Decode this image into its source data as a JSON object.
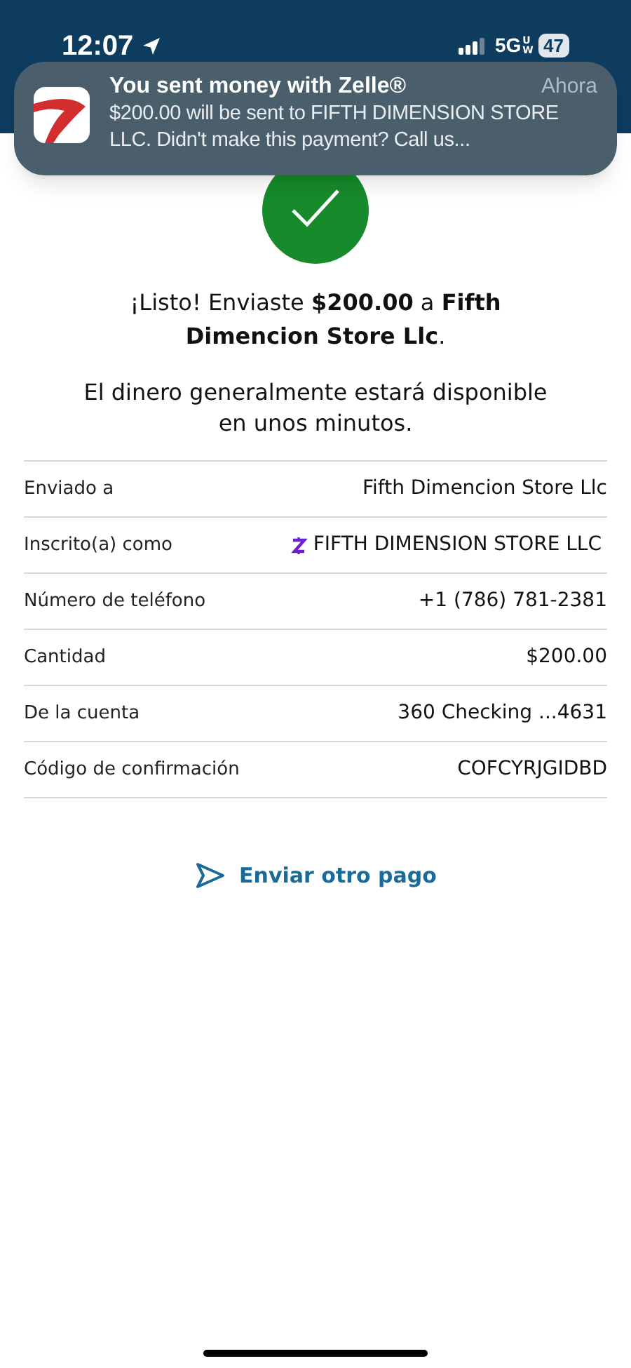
{
  "status_bar": {
    "time": "12:07",
    "network": "5G",
    "network_sub": "UW",
    "battery": "47"
  },
  "notification": {
    "title": "You sent money with Zelle®",
    "time": "Ahora",
    "body": "$200.00 will be sent to FIFTH DIMENSION STORE LLC. Didn't make this payment? Call us..."
  },
  "confirmation": {
    "headline": "¡Listo! Enviaste **$200.00** a **Fifth Dimencion Store Llc**.",
    "message": "El dinero generalmente estará disponible en unos minutos."
  },
  "details": [
    {
      "label": "Enviado a",
      "value": "Fifth Dimencion Store Llc",
      "kind": "plain"
    },
    {
      "label": "Inscrito(a) como",
      "value": "FIFTH DIMENSION STORE LLC",
      "kind": "zelle"
    },
    {
      "label": "Número de teléfono",
      "value": "+1 (786) 781-2381",
      "kind": "plain"
    },
    {
      "label": "Cantidad",
      "value": "$200.00",
      "kind": "plain"
    },
    {
      "label": "De la cuenta",
      "value": "360 Checking ...4631",
      "kind": "plain"
    },
    {
      "label": "Código de confirmación",
      "value": "COFCYRJGIDBD",
      "kind": "plain"
    }
  ],
  "action": {
    "label": "Enviar otro pago"
  }
}
